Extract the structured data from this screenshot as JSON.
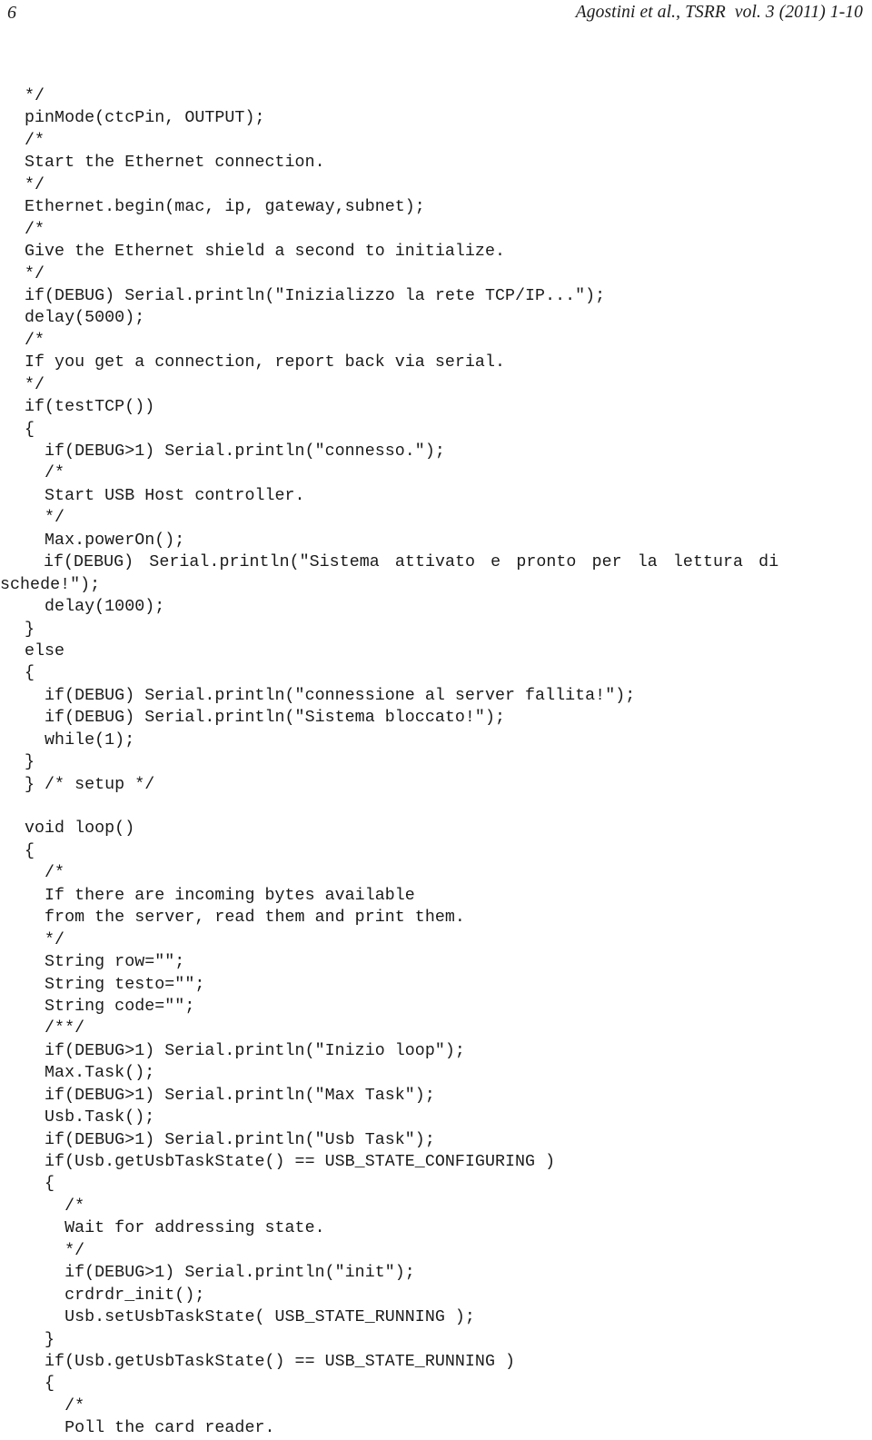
{
  "header": {
    "folio": "6",
    "running_title": "Agostini et al., TSRR  vol. 3 (2011) 1-10"
  },
  "code": {
    "lines": [
      {
        "text": "*/"
      },
      {
        "text": "pinMode(ctcPin, OUTPUT);"
      },
      {
        "text": "/*"
      },
      {
        "text": "Start the Ethernet connection."
      },
      {
        "text": "*/"
      },
      {
        "text": "Ethernet.begin(mac, ip, gateway,subnet);"
      },
      {
        "text": "/*"
      },
      {
        "text": "Give the Ethernet shield a second to initialize."
      },
      {
        "text": "*/"
      },
      {
        "text": "if(DEBUG) Serial.println(\"Inizializzo la rete TCP/IP...\");"
      },
      {
        "text": "delay(5000);"
      },
      {
        "text": "/*"
      },
      {
        "text": "If you get a connection, report back via serial."
      },
      {
        "text": "*/"
      },
      {
        "text": "if(testTCP())"
      },
      {
        "text": "{"
      },
      {
        "text": "  if(DEBUG>1) Serial.println(\"connesso.\");"
      },
      {
        "text": "  /*"
      },
      {
        "text": "  Start USB Host controller."
      },
      {
        "text": "  */"
      },
      {
        "text": "  Max.powerOn();"
      },
      {
        "text": "if(DEBUG) Serial.println(\"Sistema attivato e pronto per la lettura di",
        "style": "justified"
      },
      {
        "text": "schede!\");",
        "style": "continuation"
      },
      {
        "text": "  delay(1000);"
      },
      {
        "text": "}"
      },
      {
        "text": "else"
      },
      {
        "text": "{"
      },
      {
        "text": "  if(DEBUG) Serial.println(\"connessione al server fallita!\");"
      },
      {
        "text": "  if(DEBUG) Serial.println(\"Sistema bloccato!\");"
      },
      {
        "text": "  while(1);"
      },
      {
        "text": "}"
      },
      {
        "text": "} /* setup */"
      },
      {
        "text": "",
        "style": "blank"
      },
      {
        "text": "void loop()"
      },
      {
        "text": "{"
      },
      {
        "text": "  /*"
      },
      {
        "text": "  If there are incoming bytes available"
      },
      {
        "text": "  from the server, read them and print them."
      },
      {
        "text": "  */"
      },
      {
        "text": "  String row=\"\";"
      },
      {
        "text": "  String testo=\"\";"
      },
      {
        "text": "  String code=\"\";"
      },
      {
        "text": "  /**/"
      },
      {
        "text": "  if(DEBUG>1) Serial.println(\"Inizio loop\");"
      },
      {
        "text": "  Max.Task();"
      },
      {
        "text": "  if(DEBUG>1) Serial.println(\"Max Task\");"
      },
      {
        "text": "  Usb.Task();"
      },
      {
        "text": "  if(DEBUG>1) Serial.println(\"Usb Task\");"
      },
      {
        "text": "  if(Usb.getUsbTaskState() == USB_STATE_CONFIGURING )"
      },
      {
        "text": "  {"
      },
      {
        "text": "    /*"
      },
      {
        "text": "    Wait for addressing state."
      },
      {
        "text": "    */"
      },
      {
        "text": "    if(DEBUG>1) Serial.println(\"init\");"
      },
      {
        "text": "    crdrdr_init();"
      },
      {
        "text": "    Usb.setUsbTaskState( USB_STATE_RUNNING );"
      },
      {
        "text": "  }"
      },
      {
        "text": "  if(Usb.getUsbTaskState() == USB_STATE_RUNNING )"
      },
      {
        "text": "  {"
      },
      {
        "text": "    /*"
      },
      {
        "text": "    Poll the card reader."
      }
    ]
  }
}
